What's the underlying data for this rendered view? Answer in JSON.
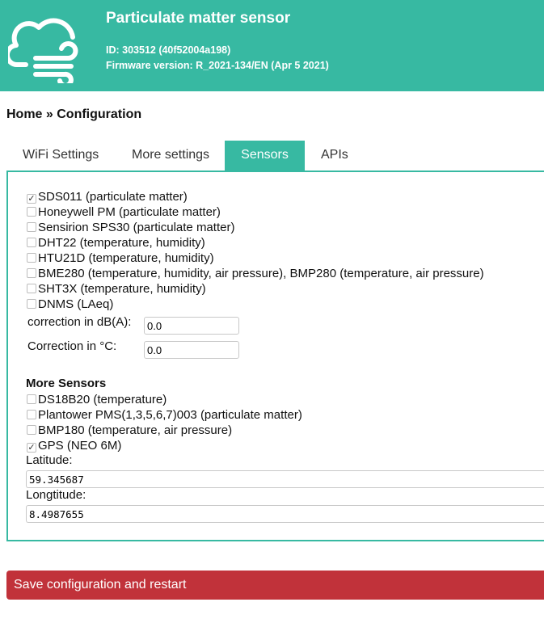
{
  "header": {
    "title": "Particulate matter sensor",
    "id_line": "ID: 303512 (40f52004a198)",
    "firmware_line": "Firmware version: R_2021-134/EN (Apr 5 2021)",
    "logo_icon": "cloud-wind-icon",
    "bg_color": "#37b9a2"
  },
  "breadcrumb": "Home » Configuration",
  "tabs": [
    {
      "label": "WiFi Settings",
      "active": false
    },
    {
      "label": "More settings",
      "active": false
    },
    {
      "label": "Sensors",
      "active": true
    },
    {
      "label": "APIs",
      "active": false
    }
  ],
  "sensors": [
    {
      "label": "SDS011 (particulate matter)",
      "checked": true
    },
    {
      "label": "Honeywell PM (particulate matter)",
      "checked": false
    },
    {
      "label": "Sensirion SPS30 (particulate matter)",
      "checked": false
    },
    {
      "label": "DHT22 (temperature, humidity)",
      "checked": false
    },
    {
      "label": "HTU21D (temperature, humidity)",
      "checked": false
    },
    {
      "label": "BME280 (temperature, humidity, air pressure), BMP280 (temperature, air pressure)",
      "checked": false
    },
    {
      "label": "SHT3X (temperature, humidity)",
      "checked": false
    },
    {
      "label": "DNMS (LAeq)",
      "checked": false
    }
  ],
  "corrections": {
    "dba_label": "correction in dB(A):",
    "dba_value": "0.0",
    "temp_label": "Correction in °C:",
    "temp_value": "0.0"
  },
  "more_sensors": {
    "title": "More Sensors",
    "items": [
      {
        "label": "DS18B20 (temperature)",
        "checked": false
      },
      {
        "label": "Plantower PMS(1,3,5,6,7)003 (particulate matter)",
        "checked": false
      },
      {
        "label": "BMP180 (temperature, air pressure)",
        "checked": false
      },
      {
        "label": "GPS (NEO 6M)",
        "checked": true
      }
    ]
  },
  "gps": {
    "latitude_label": "Latitude:",
    "latitude_value": "59.345687",
    "longitude_label": "Longtitude:",
    "longitude_value": "8.4987655"
  },
  "save_button": {
    "label": "Save configuration and restart",
    "color": "#c1323a"
  },
  "accent_color": "#37b9a2"
}
